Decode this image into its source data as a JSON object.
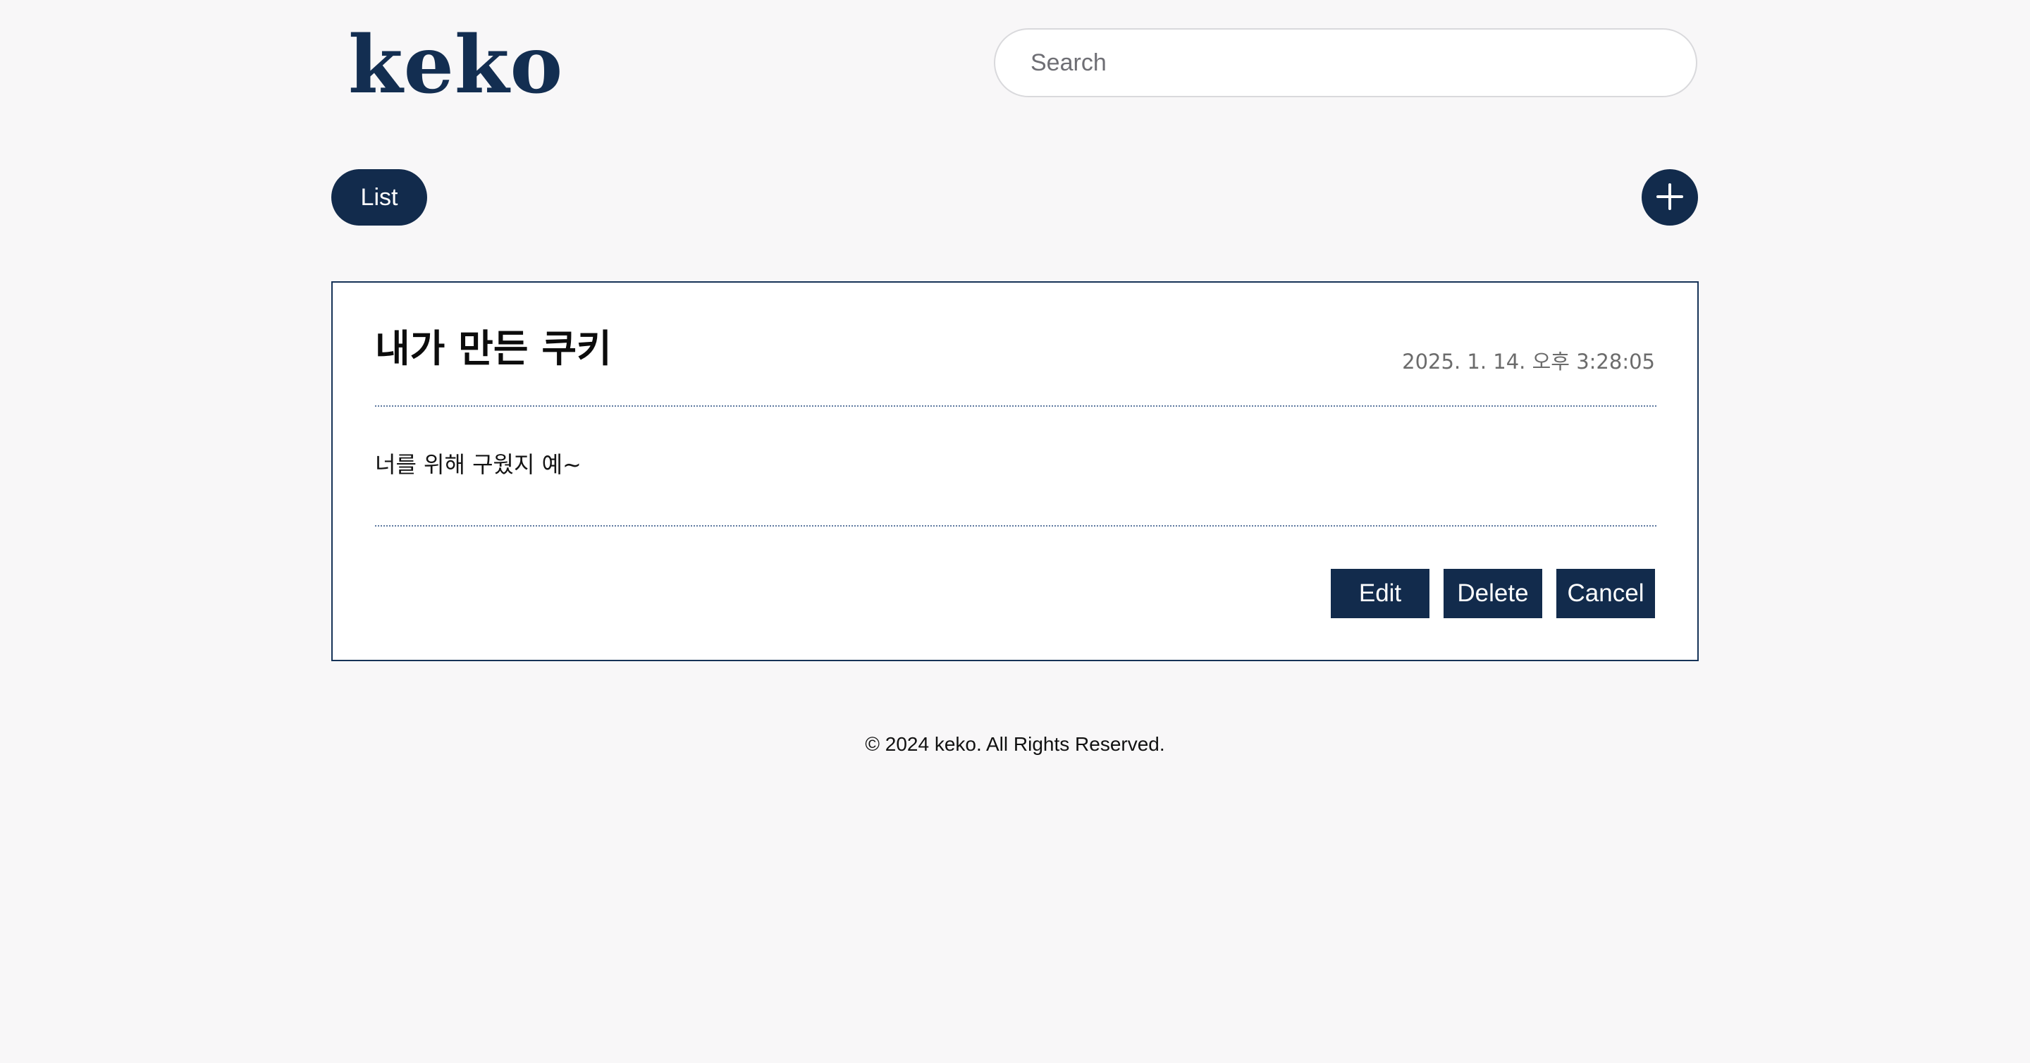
{
  "header": {
    "logo_text": "keko",
    "search": {
      "placeholder": "Search",
      "value": ""
    }
  },
  "toolbar": {
    "list_label": "List",
    "add_icon": "plus-icon"
  },
  "post": {
    "title": "내가 만든 쿠키",
    "date": "2025. 1. 14. 오후 3:28:05",
    "body": "너를 위해 구웠지 예~",
    "actions": {
      "edit_label": "Edit",
      "delete_label": "Delete",
      "cancel_label": "Cancel"
    }
  },
  "footer": {
    "copyright": "© 2024 keko. All Rights Reserved."
  },
  "colors": {
    "primary": "#122b4c",
    "background": "#f8f7f8",
    "card_border": "#163358",
    "divider": "#5e79a0",
    "date_text": "#6b6b6b"
  }
}
